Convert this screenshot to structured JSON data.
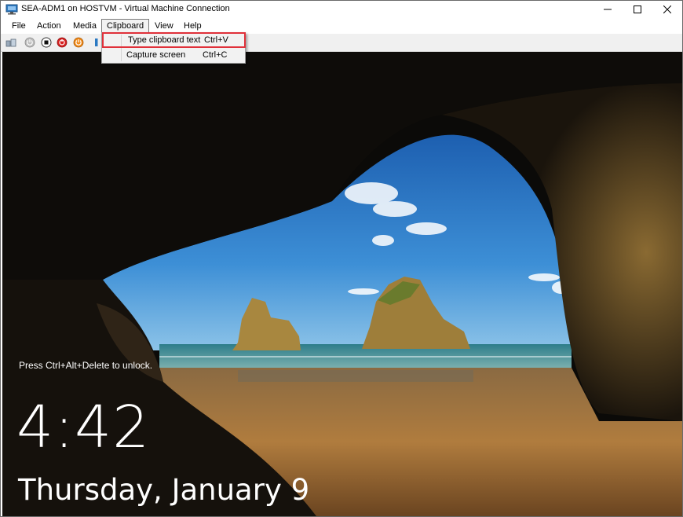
{
  "window": {
    "title": "SEA-ADM1 on HOSTVM - Virtual Machine Connection",
    "controls": {
      "minimize": "─",
      "maximize": "☐",
      "close": "✕"
    }
  },
  "menubar": {
    "items": [
      "File",
      "Action",
      "Media",
      "Clipboard",
      "View",
      "Help"
    ],
    "active": "Clipboard"
  },
  "toolbar": {
    "buttons": [
      "ctrl-alt-del-icon",
      "start-icon",
      "turn-off-icon",
      "shut-down-icon",
      "power-icon",
      "pause-icon"
    ]
  },
  "clipboard_menu": {
    "items": [
      {
        "label": "Type clipboard text",
        "shortcut": "Ctrl+V"
      },
      {
        "label": "Capture screen",
        "shortcut": "Ctrl+C"
      }
    ],
    "highlight_color": "#e0313a"
  },
  "lock_screen": {
    "hint": "Press Ctrl+Alt+Delete to unlock.",
    "time": "4:42",
    "date": "Thursday, January 9"
  },
  "colors": {
    "sky": "#2e78c4",
    "sea": "#2f8a96",
    "sand": "#b07a3a",
    "cave": "#0b0a08"
  }
}
